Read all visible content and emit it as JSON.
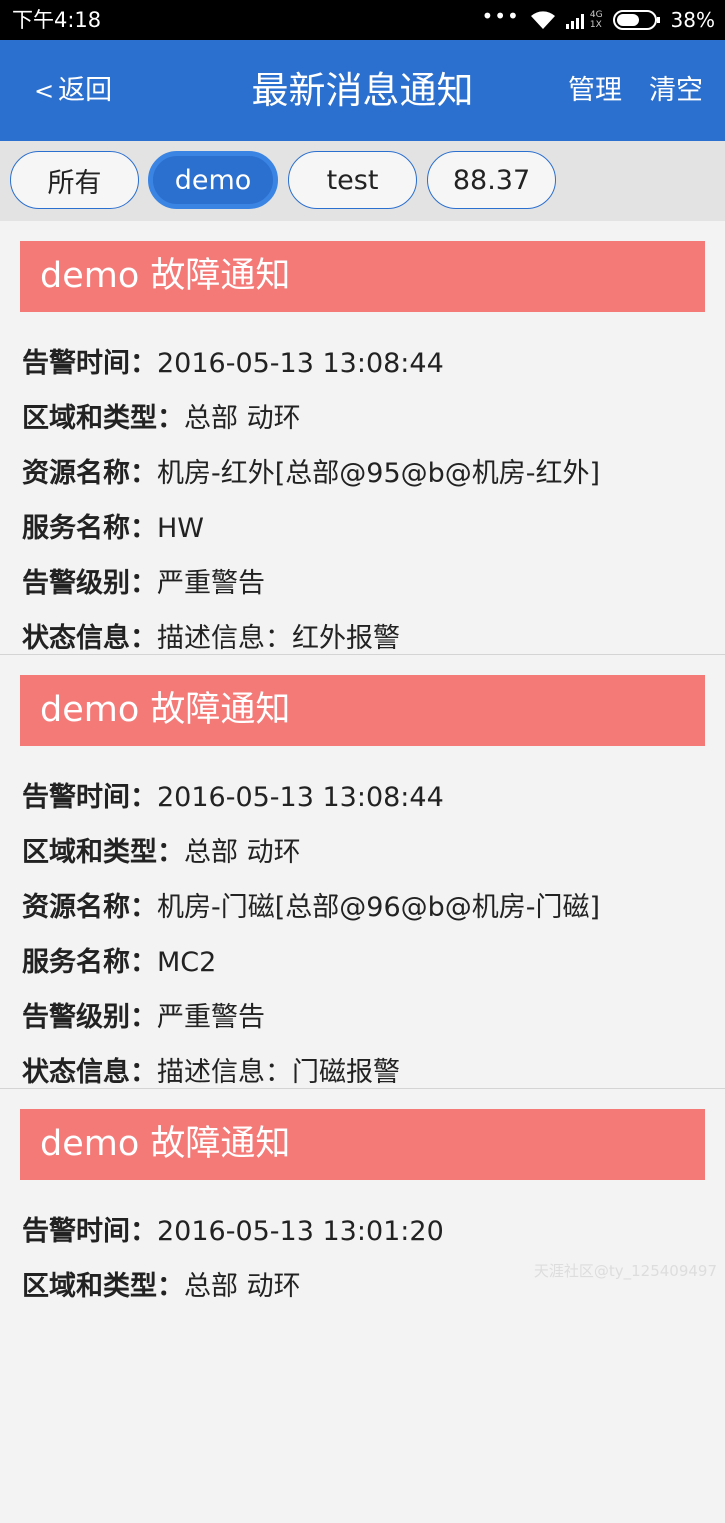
{
  "status_bar": {
    "time": "下午4:18",
    "dots": "•••",
    "net_top": "4G",
    "net_bottom": "1X",
    "battery": "38%"
  },
  "header": {
    "back_label": "返回",
    "title": "最新消息通知",
    "manage_label": "管理",
    "clear_label": "清空",
    "bg_color": "#2b6fcf"
  },
  "tabs": [
    {
      "label": "所有",
      "active": false
    },
    {
      "label": "demo",
      "active": true
    },
    {
      "label": "test",
      "active": false
    },
    {
      "label": "88.37",
      "active": false
    }
  ],
  "messages": [
    {
      "title": "demo 故障通知",
      "fields": [
        {
          "key": "告警时间",
          "value": "2016-05-13 13:08:44"
        },
        {
          "key": "区域和类型",
          "value": "总部 动环"
        },
        {
          "key": "资源名称",
          "value": "机房-红外[总部@95@b@机房-红外]"
        },
        {
          "key": "服务名称",
          "value": "HW"
        },
        {
          "key": "告警级别",
          "value": "严重警告"
        },
        {
          "key": "状态信息",
          "value": "描述信息：红外报警"
        }
      ]
    },
    {
      "title": "demo 故障通知",
      "fields": [
        {
          "key": "告警时间",
          "value": "2016-05-13 13:08:44"
        },
        {
          "key": "区域和类型",
          "value": "总部 动环"
        },
        {
          "key": "资源名称",
          "value": "机房-门磁[总部@96@b@机房-门磁]"
        },
        {
          "key": "服务名称",
          "value": "MC2"
        },
        {
          "key": "告警级别",
          "value": "严重警告"
        },
        {
          "key": "状态信息",
          "value": "描述信息：门磁报警"
        }
      ]
    },
    {
      "title": "demo 故障通知",
      "fields": [
        {
          "key": "告警时间",
          "value": "2016-05-13 13:01:20"
        },
        {
          "key": "区域和类型",
          "value": "总部 动环"
        }
      ]
    }
  ],
  "separator": "：",
  "watermark": "天涯社区@ty_125409497",
  "colors": {
    "header_bg": "#2b6fcf",
    "card_header": "#f47a78"
  }
}
